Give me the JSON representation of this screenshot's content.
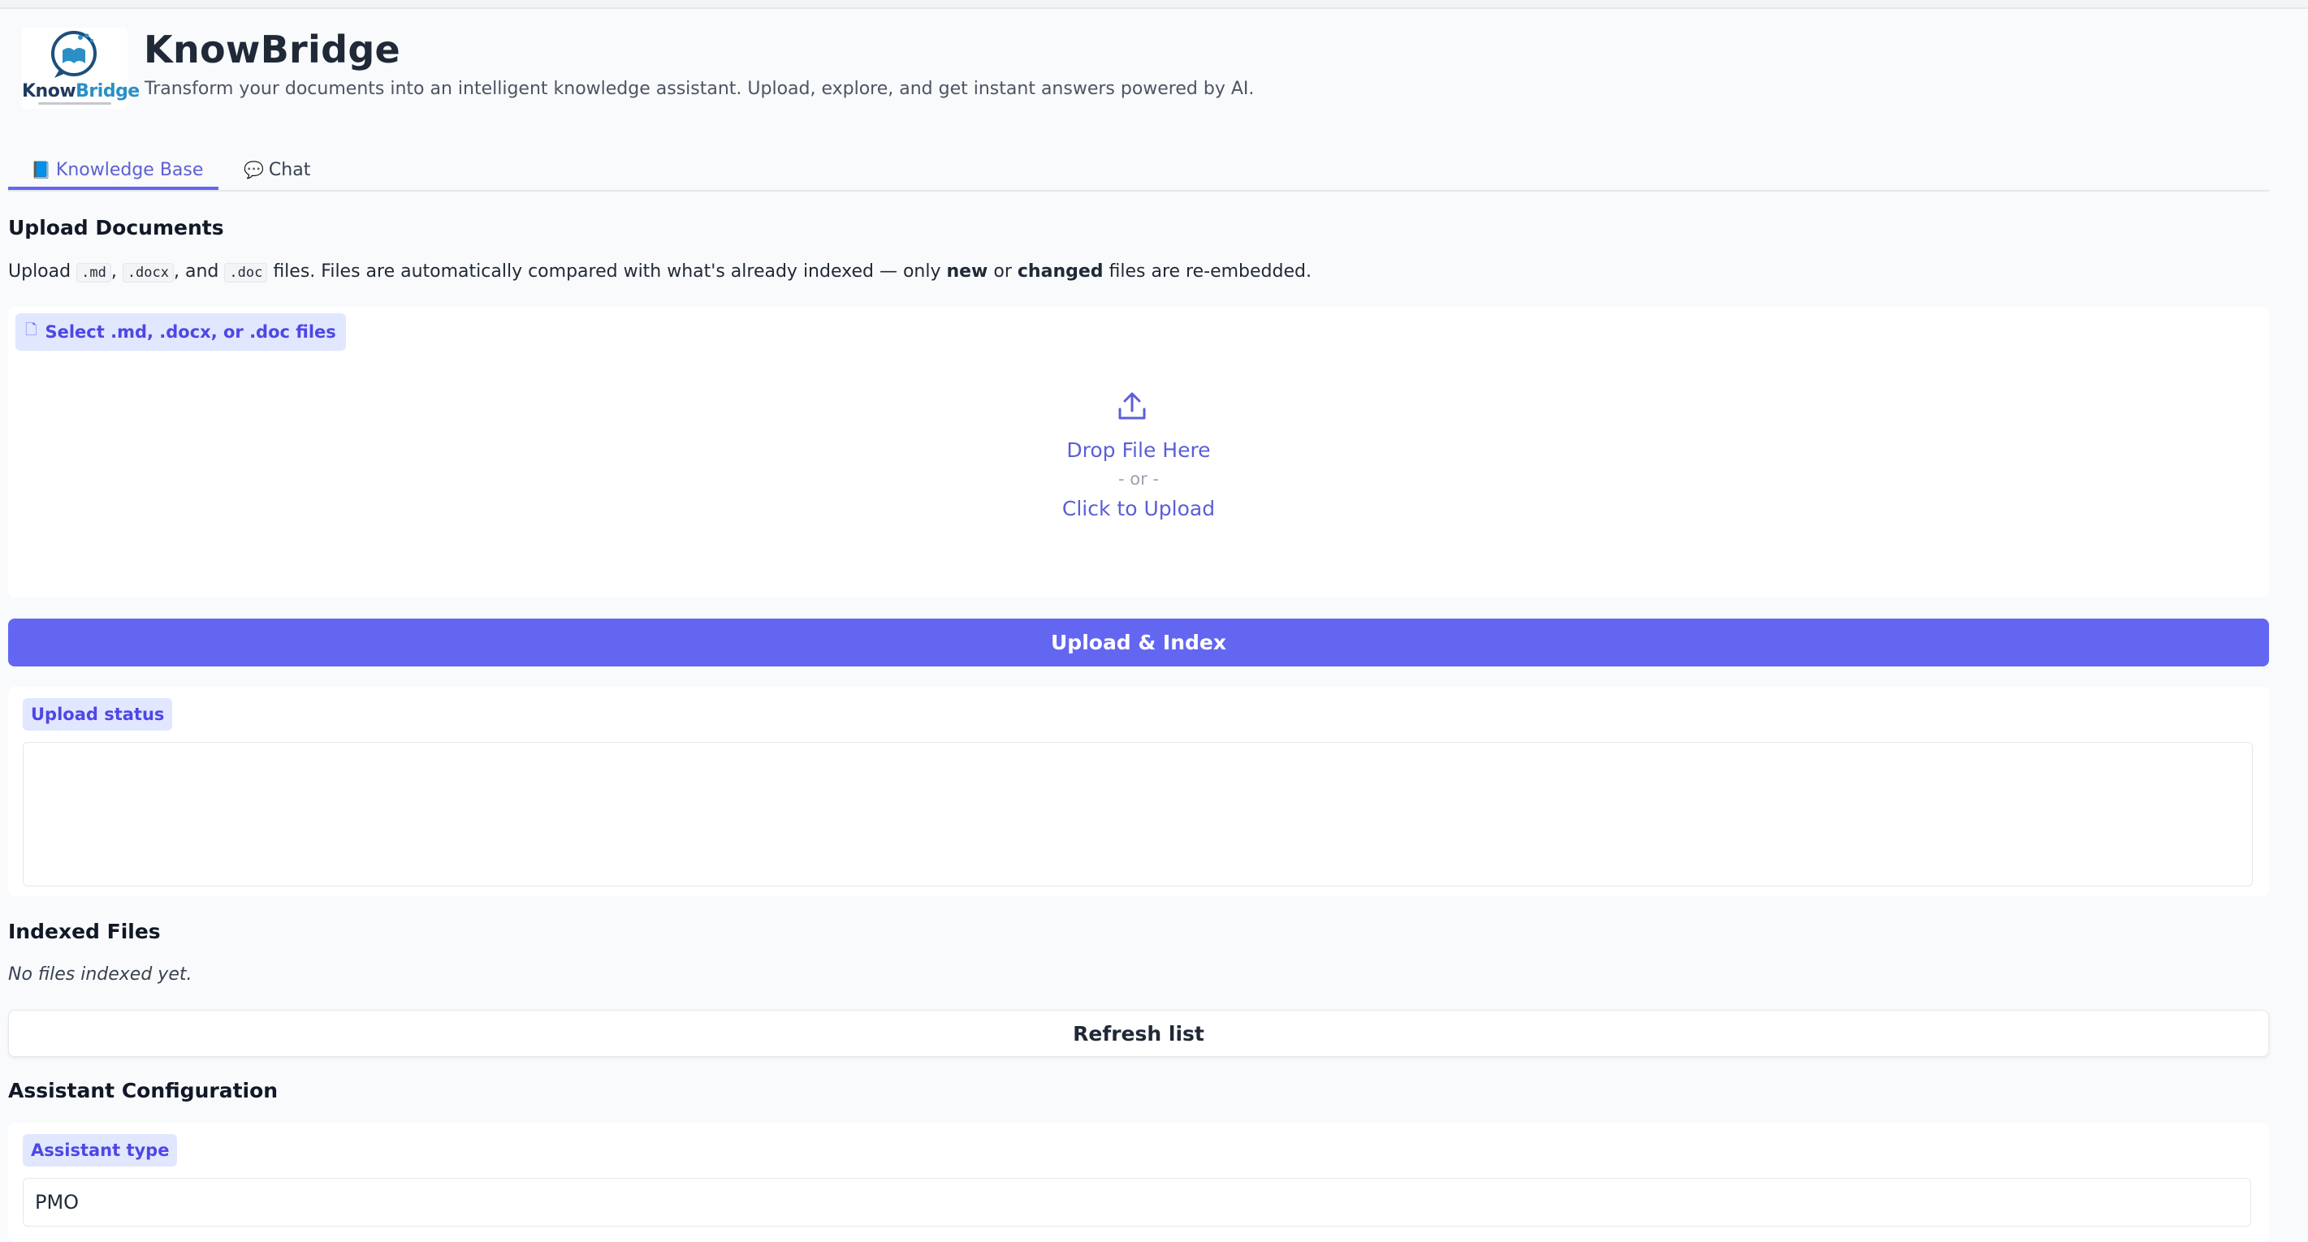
{
  "header": {
    "logo_word_main": "Know",
    "logo_word_accent": "Bridge",
    "title": "KnowBridge",
    "subtitle": "Transform your documents into an intelligent knowledge assistant. Upload, explore, and get instant answers powered by AI."
  },
  "tabs": [
    {
      "icon": "📘",
      "icon_name": "book-icon",
      "label": "Knowledge Base",
      "selected": true
    },
    {
      "icon": "💬",
      "icon_name": "speech-bubble-icon",
      "label": "Chat",
      "selected": false
    }
  ],
  "upload": {
    "heading": "Upload Documents",
    "desc": {
      "t1": "Upload ",
      "code1": ".md",
      "t2": ", ",
      "code2": ".docx",
      "t3": ", and ",
      "code3": ".doc",
      "t4": " files. Files are automatically compared with what's already indexed — only ",
      "b1": "new",
      "t5": " or ",
      "b2": "changed",
      "t6": " files are re-embedded."
    },
    "file_label": "Select .md, .docx, or .doc files",
    "drop_text": "Drop File Here",
    "or_text": "- or -",
    "click_text": "Click to Upload",
    "button_label": "Upload & Index",
    "status_label": "Upload status",
    "status_value": ""
  },
  "indexed": {
    "heading": "Indexed Files",
    "empty_note": "No files indexed yet.",
    "refresh_label": "Refresh list"
  },
  "config": {
    "heading": "Assistant Configuration",
    "type_label": "Assistant type",
    "type_value": "PMO"
  },
  "colors": {
    "accent": "#6366f1",
    "accent_text": "#5b5fd6",
    "chip_bg": "#e0e7ff",
    "page_bg": "#f9fafb"
  }
}
